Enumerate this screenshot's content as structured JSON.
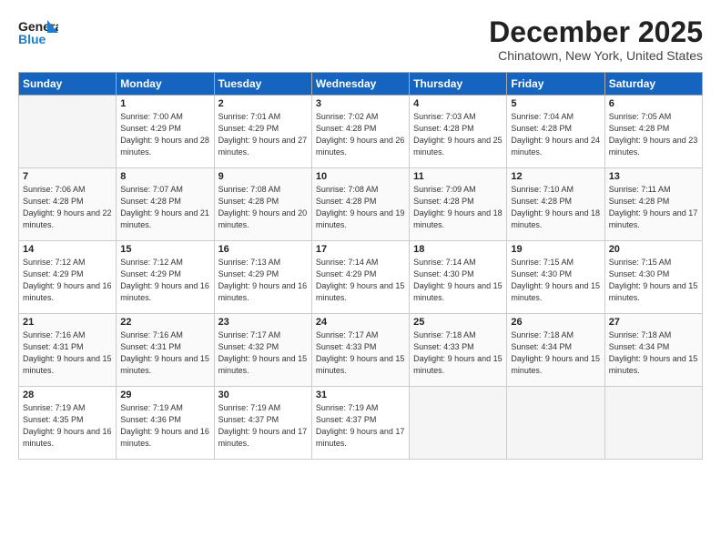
{
  "header": {
    "logo_general": "General",
    "logo_blue": "Blue",
    "title": "December 2025",
    "subtitle": "Chinatown, New York, United States"
  },
  "calendar": {
    "days_of_week": [
      "Sunday",
      "Monday",
      "Tuesday",
      "Wednesday",
      "Thursday",
      "Friday",
      "Saturday"
    ],
    "weeks": [
      [
        {
          "num": "",
          "sunrise": "",
          "sunset": "",
          "daylight": ""
        },
        {
          "num": "1",
          "sunrise": "Sunrise: 7:00 AM",
          "sunset": "Sunset: 4:29 PM",
          "daylight": "Daylight: 9 hours and 28 minutes."
        },
        {
          "num": "2",
          "sunrise": "Sunrise: 7:01 AM",
          "sunset": "Sunset: 4:29 PM",
          "daylight": "Daylight: 9 hours and 27 minutes."
        },
        {
          "num": "3",
          "sunrise": "Sunrise: 7:02 AM",
          "sunset": "Sunset: 4:28 PM",
          "daylight": "Daylight: 9 hours and 26 minutes."
        },
        {
          "num": "4",
          "sunrise": "Sunrise: 7:03 AM",
          "sunset": "Sunset: 4:28 PM",
          "daylight": "Daylight: 9 hours and 25 minutes."
        },
        {
          "num": "5",
          "sunrise": "Sunrise: 7:04 AM",
          "sunset": "Sunset: 4:28 PM",
          "daylight": "Daylight: 9 hours and 24 minutes."
        },
        {
          "num": "6",
          "sunrise": "Sunrise: 7:05 AM",
          "sunset": "Sunset: 4:28 PM",
          "daylight": "Daylight: 9 hours and 23 minutes."
        }
      ],
      [
        {
          "num": "7",
          "sunrise": "Sunrise: 7:06 AM",
          "sunset": "Sunset: 4:28 PM",
          "daylight": "Daylight: 9 hours and 22 minutes."
        },
        {
          "num": "8",
          "sunrise": "Sunrise: 7:07 AM",
          "sunset": "Sunset: 4:28 PM",
          "daylight": "Daylight: 9 hours and 21 minutes."
        },
        {
          "num": "9",
          "sunrise": "Sunrise: 7:08 AM",
          "sunset": "Sunset: 4:28 PM",
          "daylight": "Daylight: 9 hours and 20 minutes."
        },
        {
          "num": "10",
          "sunrise": "Sunrise: 7:08 AM",
          "sunset": "Sunset: 4:28 PM",
          "daylight": "Daylight: 9 hours and 19 minutes."
        },
        {
          "num": "11",
          "sunrise": "Sunrise: 7:09 AM",
          "sunset": "Sunset: 4:28 PM",
          "daylight": "Daylight: 9 hours and 18 minutes."
        },
        {
          "num": "12",
          "sunrise": "Sunrise: 7:10 AM",
          "sunset": "Sunset: 4:28 PM",
          "daylight": "Daylight: 9 hours and 18 minutes."
        },
        {
          "num": "13",
          "sunrise": "Sunrise: 7:11 AM",
          "sunset": "Sunset: 4:28 PM",
          "daylight": "Daylight: 9 hours and 17 minutes."
        }
      ],
      [
        {
          "num": "14",
          "sunrise": "Sunrise: 7:12 AM",
          "sunset": "Sunset: 4:29 PM",
          "daylight": "Daylight: 9 hours and 16 minutes."
        },
        {
          "num": "15",
          "sunrise": "Sunrise: 7:12 AM",
          "sunset": "Sunset: 4:29 PM",
          "daylight": "Daylight: 9 hours and 16 minutes."
        },
        {
          "num": "16",
          "sunrise": "Sunrise: 7:13 AM",
          "sunset": "Sunset: 4:29 PM",
          "daylight": "Daylight: 9 hours and 16 minutes."
        },
        {
          "num": "17",
          "sunrise": "Sunrise: 7:14 AM",
          "sunset": "Sunset: 4:29 PM",
          "daylight": "Daylight: 9 hours and 15 minutes."
        },
        {
          "num": "18",
          "sunrise": "Sunrise: 7:14 AM",
          "sunset": "Sunset: 4:30 PM",
          "daylight": "Daylight: 9 hours and 15 minutes."
        },
        {
          "num": "19",
          "sunrise": "Sunrise: 7:15 AM",
          "sunset": "Sunset: 4:30 PM",
          "daylight": "Daylight: 9 hours and 15 minutes."
        },
        {
          "num": "20",
          "sunrise": "Sunrise: 7:15 AM",
          "sunset": "Sunset: 4:30 PM",
          "daylight": "Daylight: 9 hours and 15 minutes."
        }
      ],
      [
        {
          "num": "21",
          "sunrise": "Sunrise: 7:16 AM",
          "sunset": "Sunset: 4:31 PM",
          "daylight": "Daylight: 9 hours and 15 minutes."
        },
        {
          "num": "22",
          "sunrise": "Sunrise: 7:16 AM",
          "sunset": "Sunset: 4:31 PM",
          "daylight": "Daylight: 9 hours and 15 minutes."
        },
        {
          "num": "23",
          "sunrise": "Sunrise: 7:17 AM",
          "sunset": "Sunset: 4:32 PM",
          "daylight": "Daylight: 9 hours and 15 minutes."
        },
        {
          "num": "24",
          "sunrise": "Sunrise: 7:17 AM",
          "sunset": "Sunset: 4:33 PM",
          "daylight": "Daylight: 9 hours and 15 minutes."
        },
        {
          "num": "25",
          "sunrise": "Sunrise: 7:18 AM",
          "sunset": "Sunset: 4:33 PM",
          "daylight": "Daylight: 9 hours and 15 minutes."
        },
        {
          "num": "26",
          "sunrise": "Sunrise: 7:18 AM",
          "sunset": "Sunset: 4:34 PM",
          "daylight": "Daylight: 9 hours and 15 minutes."
        },
        {
          "num": "27",
          "sunrise": "Sunrise: 7:18 AM",
          "sunset": "Sunset: 4:34 PM",
          "daylight": "Daylight: 9 hours and 15 minutes."
        }
      ],
      [
        {
          "num": "28",
          "sunrise": "Sunrise: 7:19 AM",
          "sunset": "Sunset: 4:35 PM",
          "daylight": "Daylight: 9 hours and 16 minutes."
        },
        {
          "num": "29",
          "sunrise": "Sunrise: 7:19 AM",
          "sunset": "Sunset: 4:36 PM",
          "daylight": "Daylight: 9 hours and 16 minutes."
        },
        {
          "num": "30",
          "sunrise": "Sunrise: 7:19 AM",
          "sunset": "Sunset: 4:37 PM",
          "daylight": "Daylight: 9 hours and 17 minutes."
        },
        {
          "num": "31",
          "sunrise": "Sunrise: 7:19 AM",
          "sunset": "Sunset: 4:37 PM",
          "daylight": "Daylight: 9 hours and 17 minutes."
        },
        {
          "num": "",
          "sunrise": "",
          "sunset": "",
          "daylight": ""
        },
        {
          "num": "",
          "sunrise": "",
          "sunset": "",
          "daylight": ""
        },
        {
          "num": "",
          "sunrise": "",
          "sunset": "",
          "daylight": ""
        }
      ]
    ]
  }
}
